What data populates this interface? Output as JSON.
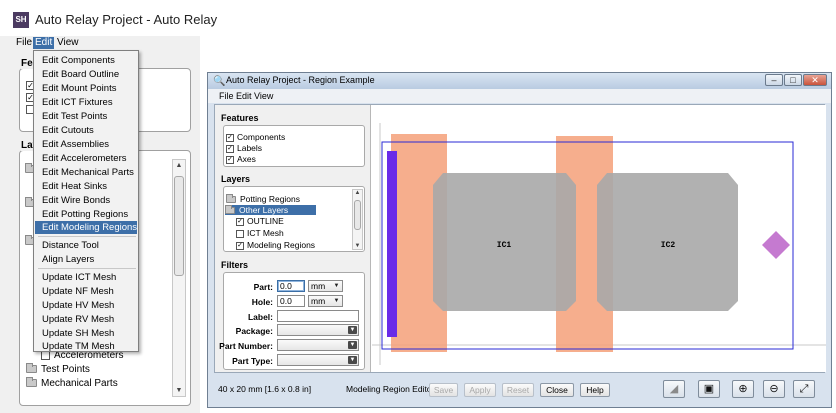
{
  "main_window": {
    "logo": "SH",
    "title": "Auto Relay Project - Auto Relay",
    "menubar": [
      "File",
      "Edit",
      "View"
    ],
    "features_group_label": "Feat",
    "layers_group_label": "Lay",
    "tree_items": [
      "Accelerometers",
      "Test Points",
      "Mechanical Parts"
    ]
  },
  "edit_menu": {
    "items": [
      "Edit Components",
      "Edit Board Outline",
      "Edit Mount Points",
      "Edit ICT Fixtures",
      "Edit Test Points",
      "Edit Cutouts",
      "Edit Assemblies",
      "Edit Accelerometers",
      "Edit Mechanical Parts",
      "Edit Heat Sinks",
      "Edit Wire Bonds",
      "Edit Potting Regions",
      "Edit Modeling Regions",
      "Distance Tool",
      "Align Layers",
      "Update ICT Mesh",
      "Update NF Mesh",
      "Update HV Mesh",
      "Update RV Mesh",
      "Update SH Mesh",
      "Update TM Mesh"
    ],
    "highlighted": "Edit Modeling Regions"
  },
  "region_window": {
    "title": "Auto Relay Project - Region Example",
    "menubar": [
      "File",
      "Edit",
      "View"
    ],
    "window_buttons": {
      "minimize": "–",
      "maximize": "□",
      "close": "✕"
    },
    "features": {
      "label": "Features",
      "items": [
        {
          "label": "Components",
          "checked": true
        },
        {
          "label": "Labels",
          "checked": true
        },
        {
          "label": "Axes",
          "checked": true
        }
      ]
    },
    "layers": {
      "label": "Layers",
      "items": [
        {
          "label": "Potting Regions",
          "type": "folder"
        },
        {
          "label": "Other Layers",
          "type": "folder",
          "selected": true
        },
        {
          "label": "OUTLINE",
          "checked": true
        },
        {
          "label": "ICT Mesh",
          "checked": false
        },
        {
          "label": "Modeling Regions",
          "checked": true
        }
      ]
    },
    "filters": {
      "label": "Filters",
      "part_label": "Part:",
      "part_value": "0.0",
      "part_unit": "mm",
      "hole_label": "Hole:",
      "hole_value": "0.0",
      "hole_unit": "mm",
      "label_label": "Label:",
      "label_value": "",
      "package_label": "Package:",
      "part_number_label": "Part Number:",
      "part_type_label": "Part Type:"
    },
    "canvas": {
      "ic1_label": "IC1",
      "ic2_label": "IC2",
      "colors": {
        "board_outline": "#2a2ad6",
        "modeling_region": "#f4a079",
        "component": "#a8a8a8",
        "left_bar": "#6a2be8",
        "diamond": "#c57ad0"
      }
    },
    "status": {
      "dimensions": "40 x 20 mm  [1.6 x 0.8 in]",
      "editor_label": "Modeling Region Editor",
      "save": "Save",
      "apply": "Apply",
      "reset": "Reset",
      "close": "Close",
      "help": "Help"
    },
    "toolbar_icons": [
      "measure-icon",
      "camera-icon",
      "zoom-in-icon",
      "zoom-out-icon",
      "fit-icon"
    ]
  }
}
